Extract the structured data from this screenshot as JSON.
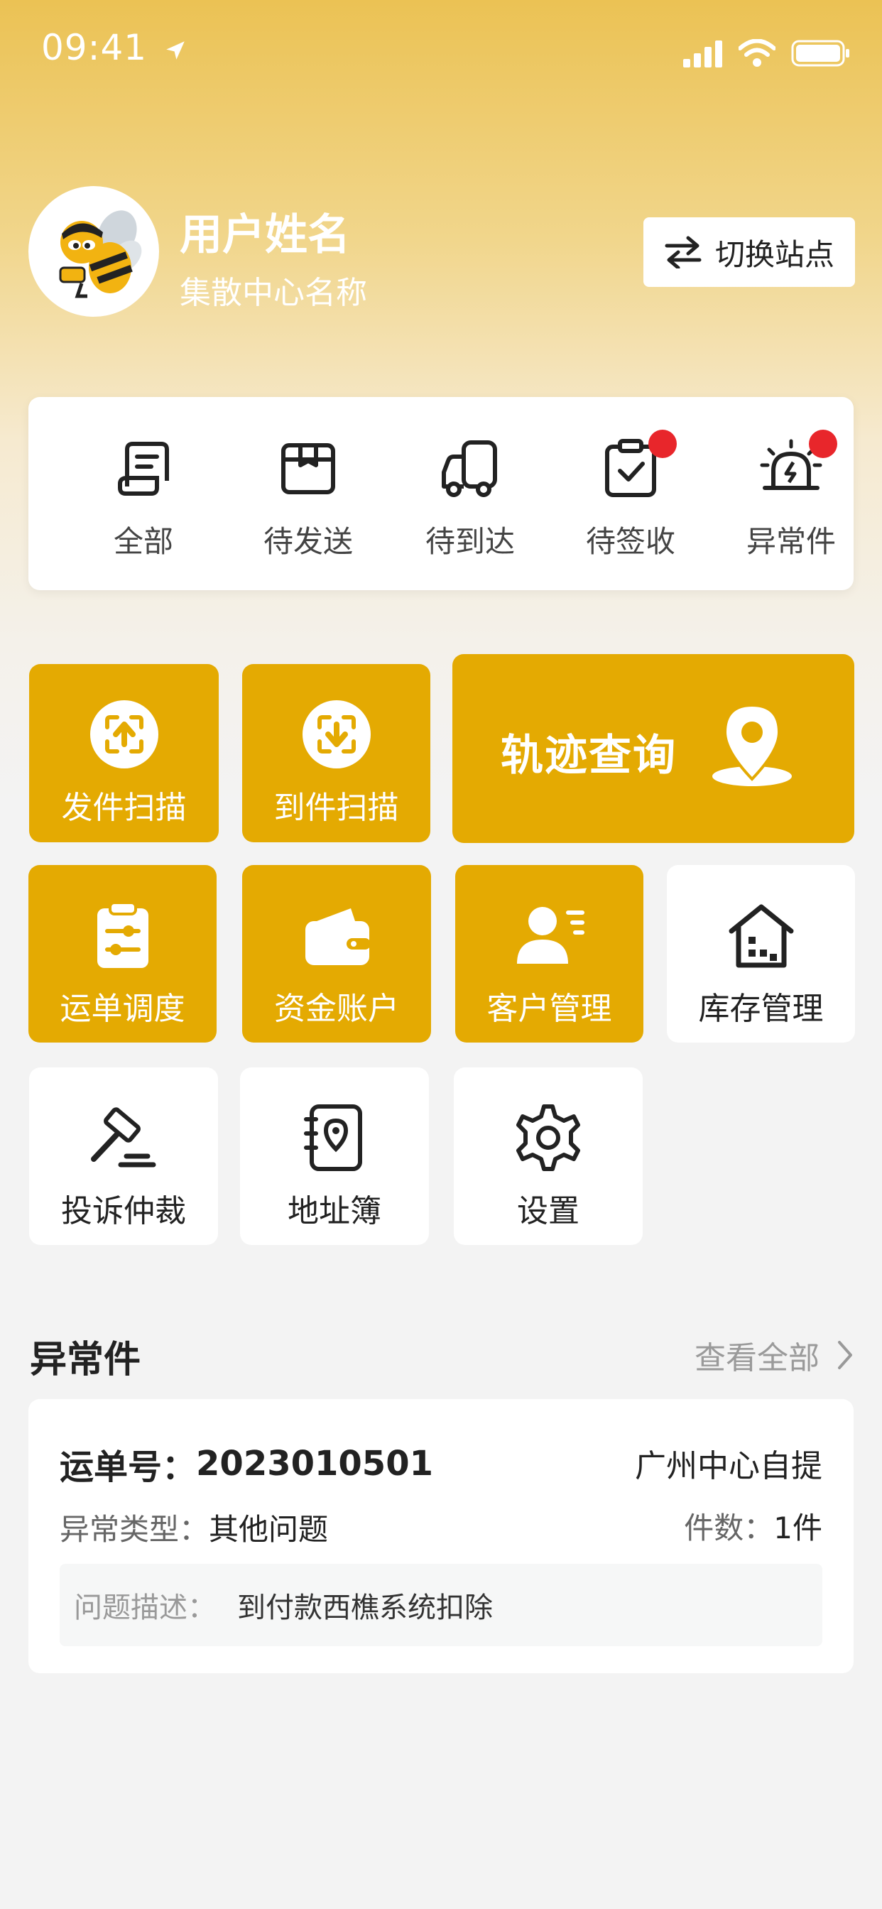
{
  "status_bar": {
    "time": "09:41"
  },
  "header": {
    "user_name": "用户姓名",
    "center_name": "集散中心名称",
    "switch_label": "切换站点"
  },
  "order_status": {
    "items": [
      {
        "label": "全部",
        "icon": "document-icon",
        "badge": false
      },
      {
        "label": "待发送",
        "icon": "box-icon",
        "badge": false
      },
      {
        "label": "待到达",
        "icon": "truck-icon",
        "badge": false
      },
      {
        "label": "待签收",
        "icon": "clipboard-check-icon",
        "badge": true
      },
      {
        "label": "异常件",
        "icon": "alarm-icon",
        "badge": true
      }
    ]
  },
  "actions": {
    "send_scan": "发件扫描",
    "arrive_scan": "到件扫描",
    "track_query": "轨迹查询",
    "waybill_dispatch": "运单调度",
    "fund_account": "资金账户",
    "customer_mgmt": "客户管理",
    "inventory_mgmt": "库存管理",
    "complaint": "投诉仲裁",
    "address_book": "地址簿",
    "settings": "设置"
  },
  "colors": {
    "accent": "#e4aa02",
    "badge": "#e8262b"
  },
  "abnormal": {
    "title": "异常件",
    "view_all": "查看全部",
    "card": {
      "waybill_label": "运单号：",
      "waybill_no": "2023010501",
      "pickup": "广州中心自提",
      "type_label": "异常类型：",
      "type_value": "其他问题",
      "count_label": "件数：",
      "count_value": "1件",
      "desc_label": "问题描述：",
      "desc_value": "到付款西樵系统扣除"
    }
  }
}
